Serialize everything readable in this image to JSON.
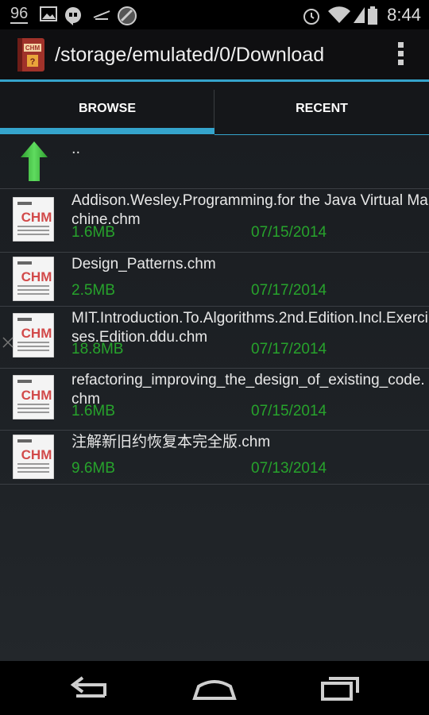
{
  "status_bar": {
    "notification_count": "96",
    "time": "8:44",
    "icons": [
      "image-icon",
      "hangouts-icon",
      "muted-icon",
      "maps-icon",
      "alarm-icon",
      "wifi-icon",
      "signal-icon",
      "battery-icon"
    ]
  },
  "action_bar": {
    "title": "/storage/emulated/0/Download",
    "app_icon": "chm-reader-icon",
    "menu_icon": "overflow-menu-icon"
  },
  "tabs": [
    {
      "label": "BROWSE",
      "selected": true
    },
    {
      "label": "RECENT",
      "selected": false
    }
  ],
  "colors": {
    "accent": "#35a4cc",
    "meta_text": "#27a32c",
    "up_arrow": "#3cc43c"
  },
  "file_list": {
    "parent_label": "..",
    "files": [
      {
        "name": "Addison.Wesley.Programming.for the Java Virtual Machine.chm",
        "size": "1.6MB",
        "date": "07/15/2014"
      },
      {
        "name": "Design_Patterns.chm",
        "size": "2.5MB",
        "date": "07/17/2014"
      },
      {
        "name": "MIT.Introduction.To.Algorithms.2nd.Edition.Incl.Exercises.Edition.ddu.chm",
        "size": "18.8MB",
        "date": "07/17/2014"
      },
      {
        "name": "refactoring_improving_the_design_of_existing_code.chm",
        "size": "1.6MB",
        "date": "07/15/2014"
      },
      {
        "name": "注解新旧约恢复本完全版.chm",
        "size": "9.6MB",
        "date": "07/13/2014"
      }
    ]
  },
  "nav_bar": [
    "back-icon",
    "home-icon",
    "recent-apps-icon"
  ]
}
